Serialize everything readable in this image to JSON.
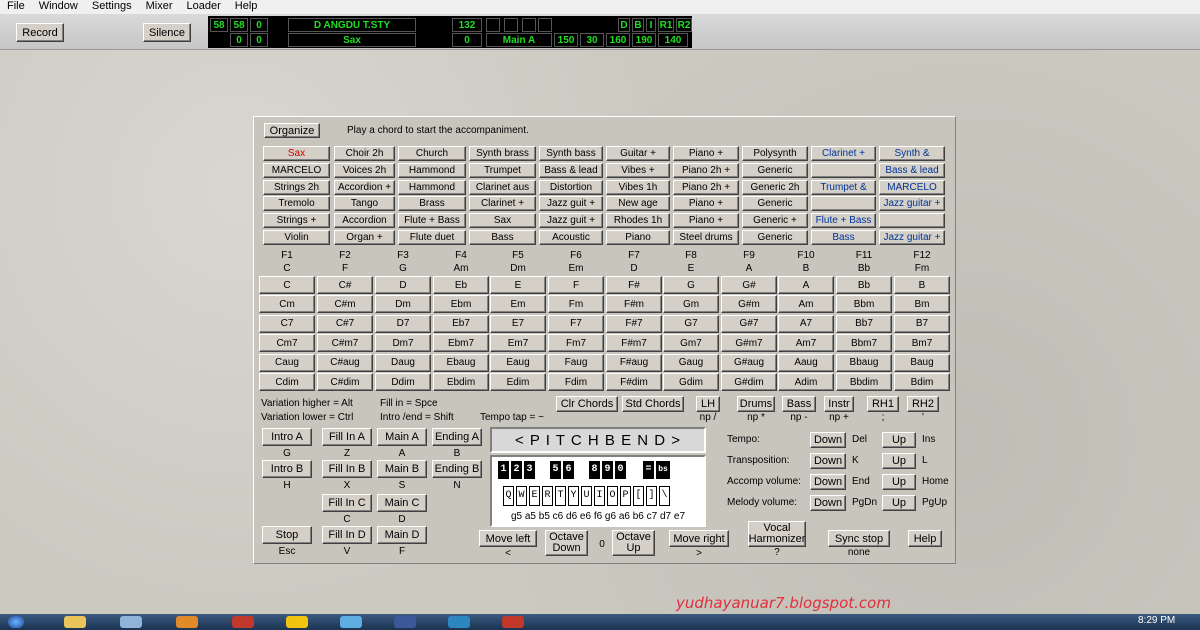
{
  "menu": [
    "File",
    "Window",
    "Settings",
    "Mixer",
    "Loader",
    "Help"
  ],
  "toolbar": {
    "record": "Record",
    "silence": "Silence"
  },
  "lcd": {
    "r1": [
      "58",
      "58",
      "0",
      "D ANGDU T.STY",
      "132",
      "",
      "",
      "",
      "",
      "D",
      "B",
      "I",
      "R1",
      "R2"
    ],
    "r2": [
      "0",
      "0",
      "Sax",
      "0",
      "Main A",
      "150",
      "30",
      "160",
      "190",
      "140"
    ]
  },
  "header": {
    "organize": "Organize",
    "hint": "Play a chord to start the accompaniment."
  },
  "voices": [
    [
      "Sax",
      "Choir 2h",
      "Church",
      "Synth brass",
      "Synth bass",
      "Guitar +",
      "Piano +",
      "Polysynth",
      "Clarinet +",
      "Synth &"
    ],
    [
      "MARCELO",
      "Voices 2h",
      "Hammond",
      "Trumpet",
      "Bass & lead",
      "Vibes +",
      "Piano 2h +",
      "Generic",
      "",
      "Bass & lead"
    ],
    [
      "Strings 2h",
      "Accordion +",
      "Hammond",
      "Clarinet aus",
      "Distortion",
      "Vibes 1h",
      "Piano 2h +",
      "Generic 2h",
      "Trumpet &",
      "MARCELO"
    ],
    [
      "Tremolo",
      "Tango",
      "Brass",
      "Clarinet +",
      "Jazz guit +",
      "New age",
      "Piano +",
      "Generic",
      "",
      "Jazz guitar +"
    ],
    [
      "Strings +",
      "Accordion",
      "Flute + Bass",
      "Sax",
      "Jazz guit +",
      "Rhodes 1h",
      "Piano +",
      "Generic +",
      "Flute + Bass",
      ""
    ],
    [
      "Violin",
      "Organ +",
      "Flute duet",
      "Bass",
      "Acoustic",
      "Piano",
      "Steel drums",
      "Generic",
      "Bass",
      "Jazz guitar +"
    ]
  ],
  "fkeys": [
    "F1",
    "F2",
    "F3",
    "F4",
    "F5",
    "F6",
    "F7",
    "F8",
    "F9",
    "F10",
    "F11",
    "F12"
  ],
  "fnotes": [
    "C",
    "F",
    "G",
    "Am",
    "Dm",
    "Em",
    "D",
    "E",
    "A",
    "B",
    "Bb",
    "Fm"
  ],
  "chords": [
    [
      "C",
      "C#",
      "D",
      "Eb",
      "E",
      "F",
      "F#",
      "G",
      "G#",
      "A",
      "Bb",
      "B"
    ],
    [
      "Cm",
      "C#m",
      "Dm",
      "Ebm",
      "Em",
      "Fm",
      "F#m",
      "Gm",
      "G#m",
      "Am",
      "Bbm",
      "Bm"
    ],
    [
      "C7",
      "C#7",
      "D7",
      "Eb7",
      "E7",
      "F7",
      "F#7",
      "G7",
      "G#7",
      "A7",
      "Bb7",
      "B7"
    ],
    [
      "Cm7",
      "C#m7",
      "Dm7",
      "Ebm7",
      "Em7",
      "Fm7",
      "F#m7",
      "Gm7",
      "G#m7",
      "Am7",
      "Bbm7",
      "Bm7"
    ],
    [
      "Caug",
      "C#aug",
      "Daug",
      "Ebaug",
      "Eaug",
      "Faug",
      "F#aug",
      "Gaug",
      "G#aug",
      "Aaug",
      "Bbaug",
      "Baug"
    ],
    [
      "Cdim",
      "C#dim",
      "Ddim",
      "Ebdim",
      "Edim",
      "Fdim",
      "F#dim",
      "Gdim",
      "G#dim",
      "Adim",
      "Bbdim",
      "Bdim"
    ]
  ],
  "info": {
    "var_hi": "Variation higher = Alt",
    "var_lo": "Variation lower = Ctrl",
    "fill": "Fill in = Spce",
    "intro": "Intro /end = Shift",
    "tempo_tap": "Tempo tap = ~"
  },
  "chordbtns": {
    "clr": "Clr Chords",
    "std": "Std Chords"
  },
  "parts": [
    {
      "label": "LH",
      "key": "np /"
    },
    {
      "label": "Drums",
      "key": "np *"
    },
    {
      "label": "Bass",
      "key": "np -"
    },
    {
      "label": "Instr",
      "key": "np +"
    },
    {
      "label": "RH1",
      "key": ";"
    },
    {
      "label": "RH2",
      "key": "'"
    }
  ],
  "style": {
    "intro_a": "Intro A",
    "intro_a_k": "G",
    "fill_a": "Fill In A",
    "fill_a_k": "Z",
    "main_a": "Main A",
    "main_a_k": "A",
    "ending_a": "Ending A",
    "ending_a_k": "B",
    "intro_b": "Intro B",
    "intro_b_k": "H",
    "fill_b": "Fill In B",
    "fill_b_k": "X",
    "main_b": "Main B",
    "main_b_k": "S",
    "ending_b": "Ending B",
    "ending_b_k": "N",
    "fill_c": "Fill In C",
    "fill_c_k": "C",
    "main_c": "Main C",
    "main_c_k": "D",
    "stop": "Stop",
    "stop_k": "Esc",
    "fill_d": "Fill In D",
    "fill_d_k": "V",
    "main_d": "Main D",
    "main_d_k": "F"
  },
  "pitchbend": "< P I T C H B E N D >",
  "kb_top": [
    "1",
    "2",
    "3",
    "5",
    "6",
    "8",
    "9",
    "0",
    "=",
    "bs"
  ],
  "kb_bot": [
    "Q",
    "W",
    "E",
    "R",
    "T",
    "Y",
    "U",
    "I",
    "O",
    "P",
    "[",
    "]",
    "\\"
  ],
  "notes": "g5 a5 b5 c6 d6 e6 f6 g6 a6 b6 c7 d7 e7",
  "move": {
    "left": "Move left",
    "left_k": "<",
    "oct_down": "Octave Down",
    "oct_val": "0",
    "oct_up": "Octave Up",
    "right": "Move right",
    "right_k": ">"
  },
  "controls": [
    {
      "label": "Tempo:",
      "down": "Down",
      "dk": "Del",
      "up": "Up",
      "uk": "Ins"
    },
    {
      "label": "Transposition:",
      "down": "Down",
      "dk": "K",
      "up": "Up",
      "uk": "L"
    },
    {
      "label": "Accomp volume:",
      "down": "Down",
      "dk": "End",
      "up": "Up",
      "uk": "Home"
    },
    {
      "label": "Melody volume:",
      "down": "Down",
      "dk": "PgDn",
      "up": "Up",
      "uk": "PgUp"
    }
  ],
  "bottom": {
    "vocal": "Vocal Harmonizer",
    "vocal_k": "?",
    "sync": "Sync stop",
    "sync_k": "none",
    "help": "Help"
  },
  "watermark": "yudhayanuar7.blogspot.com",
  "clock": "8:29 PM"
}
